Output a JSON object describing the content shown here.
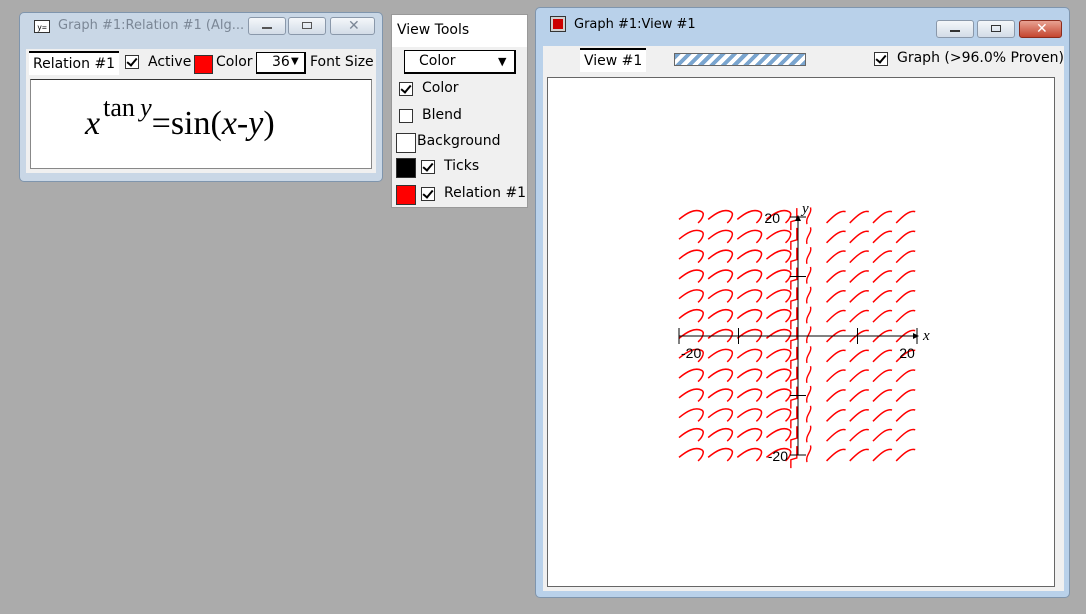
{
  "relation_window": {
    "title": "Graph #1:Relation #1 (Alg...",
    "toolbar": {
      "relation_label": "Relation #1",
      "active_label": "Active",
      "active_checked": true,
      "color_label": "Color",
      "color_value": "#ff0000",
      "font_size_value": "36",
      "font_size_label": "Font Size"
    },
    "equation": {
      "base": "x",
      "exponent": "tan",
      "exponent_var": "y",
      "equals": "=",
      "function": "sin",
      "open_paren": "(",
      "arg1": "x",
      "minus": "-",
      "arg2": "y",
      "close_paren": ")"
    }
  },
  "view_tools": {
    "title": "View Tools",
    "mode_select": "Color",
    "options": [
      {
        "label": "Color",
        "checked": true
      },
      {
        "label": "Blend",
        "checked": false
      }
    ],
    "background": {
      "label": "Background",
      "color": "#ffffff"
    },
    "ticks": {
      "label": "Ticks",
      "color": "#000000",
      "checked": true
    },
    "relation": {
      "label": "Relation #1",
      "color": "#ff0000",
      "checked": true
    }
  },
  "graph_window": {
    "title": "Graph #1:View #1",
    "view_label": "View #1",
    "graph_checked": true,
    "graph_label": "Graph (>96.0% Proven)"
  },
  "chart_data": {
    "type": "line",
    "title": "",
    "relation": "x^(tan y) = sin(x - y)",
    "xlabel": "x",
    "ylabel": "y",
    "xlim": [
      -20,
      20
    ],
    "ylim": [
      -20,
      20
    ],
    "x_tick_labels": [
      "-20",
      "20"
    ],
    "y_tick_labels": [
      "20",
      "-20"
    ],
    "curve_color": "#ff0000",
    "grid": false
  }
}
